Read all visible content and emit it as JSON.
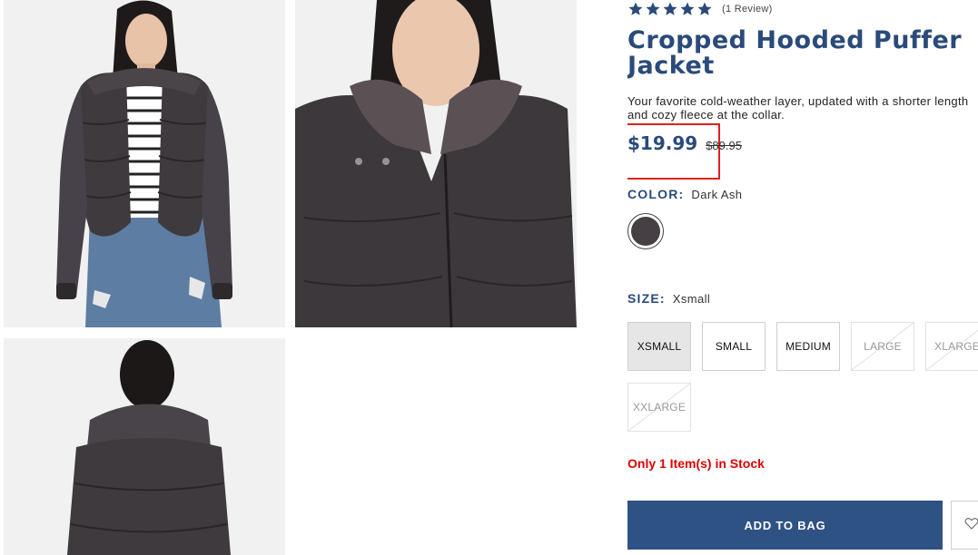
{
  "product": {
    "rating_stars": 5,
    "review_count": "(1 Review)",
    "title": "Cropped Hooded Puffer Jacket",
    "description": "Your favorite cold-weather layer, updated with a shorter length and cozy fleece at the collar.",
    "price": "$19.99",
    "original_price": "$89.95"
  },
  "color": {
    "label": "COLOR:",
    "selected": "Dark Ash",
    "swatch_hex": "#463f44"
  },
  "size": {
    "label": "SIZE:",
    "selected": "Xsmall",
    "options": [
      {
        "label": "XSMALL",
        "state": "selected"
      },
      {
        "label": "SMALL",
        "state": "available"
      },
      {
        "label": "MEDIUM",
        "state": "available"
      },
      {
        "label": "LARGE",
        "state": "unavailable"
      },
      {
        "label": "XLARGE",
        "state": "unavailable"
      },
      {
        "label": "XXLARGE",
        "state": "unavailable"
      }
    ]
  },
  "stock_message": "Only 1 Item(s) in Stock",
  "actions": {
    "add_to_bag": "ADD TO BAG",
    "wishlist_icon": "heart-icon"
  },
  "colors": {
    "brand_blue": "#2a4a7a",
    "button_blue": "#2f5284",
    "stock_red": "#e00000",
    "highlight_red": "#e02020"
  }
}
